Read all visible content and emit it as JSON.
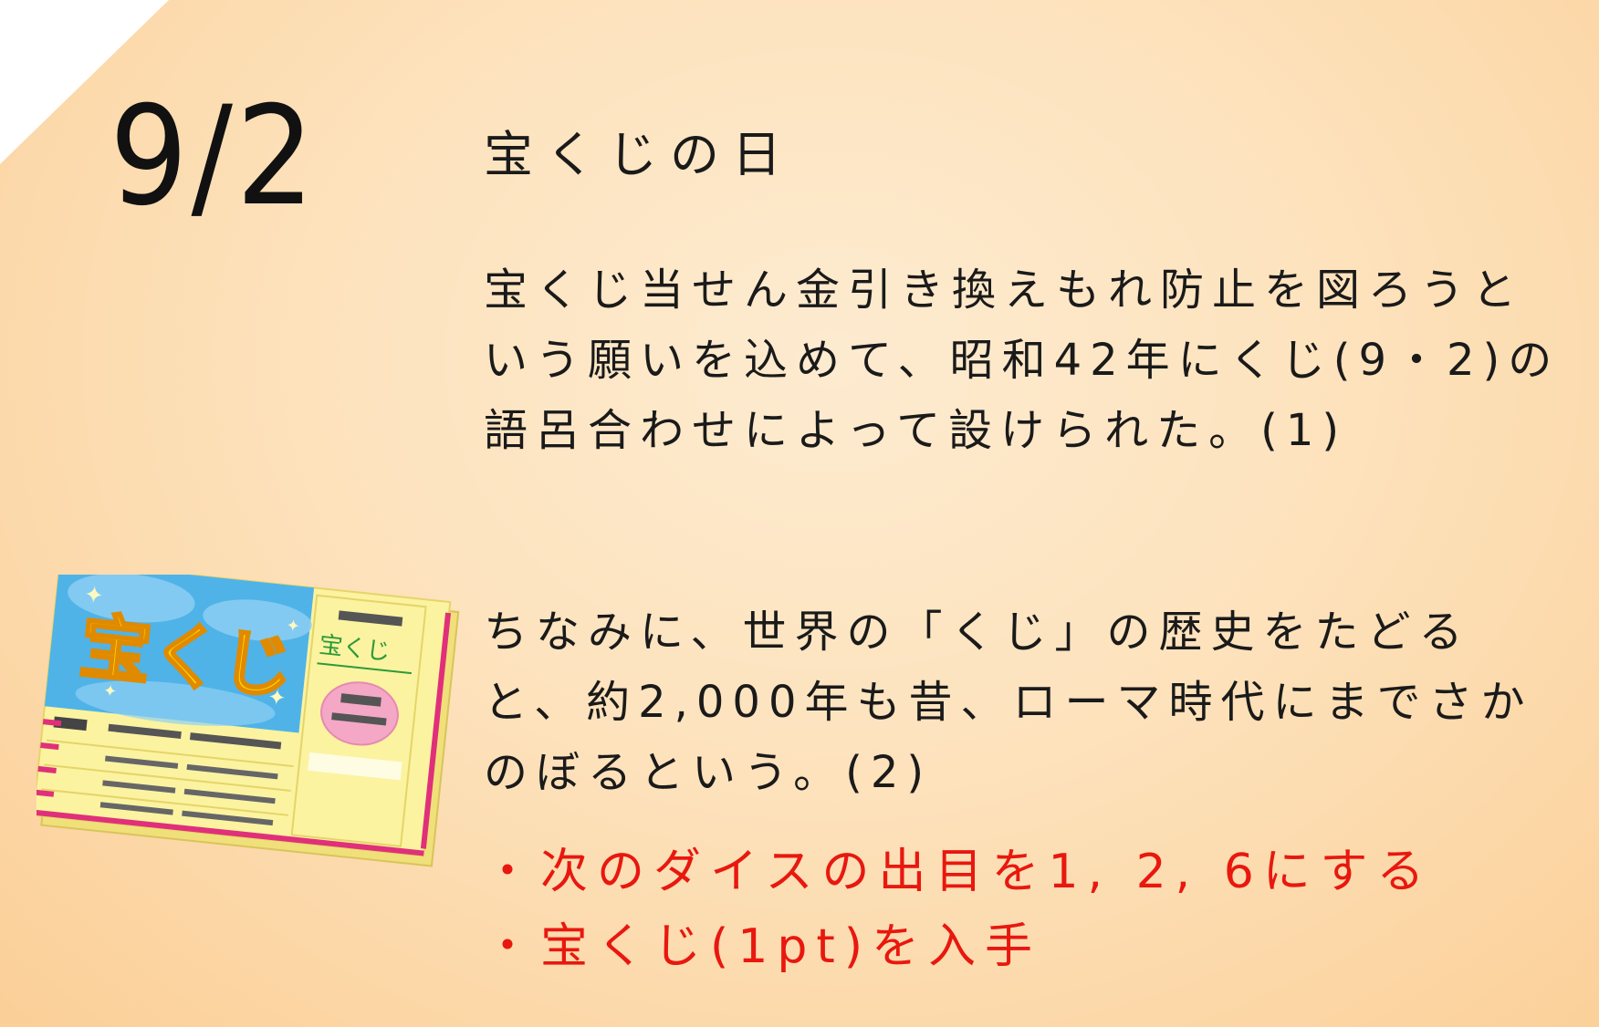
{
  "date": "9/2",
  "title": "宝くじの日",
  "description": "宝くじ当せん金引き換えもれ防止を図ろうという願いを込めて、昭和42年にくじ(9・2)の語呂合わせによって設けられた。(1)",
  "trivia": "ちなみに、世界の「くじ」の歴史をたどると、約2,000年も昔、ローマ時代にまでさかのぼるという。(2)",
  "effects": [
    "・次のダイスの出目を1, 2, 6にする",
    "・宝くじ(1pt)を入手"
  ],
  "illustration": {
    "icon": "lottery-ticket-icon",
    "main_text": "宝くじ",
    "stub_text": "宝くじ"
  },
  "colors": {
    "effect_text": "#e8180f",
    "ticket_sky": "#4fb3e8",
    "ticket_title": "#ffd400",
    "ticket_paper": "#fbf3a0",
    "ticket_stripe": "#e0307a"
  }
}
